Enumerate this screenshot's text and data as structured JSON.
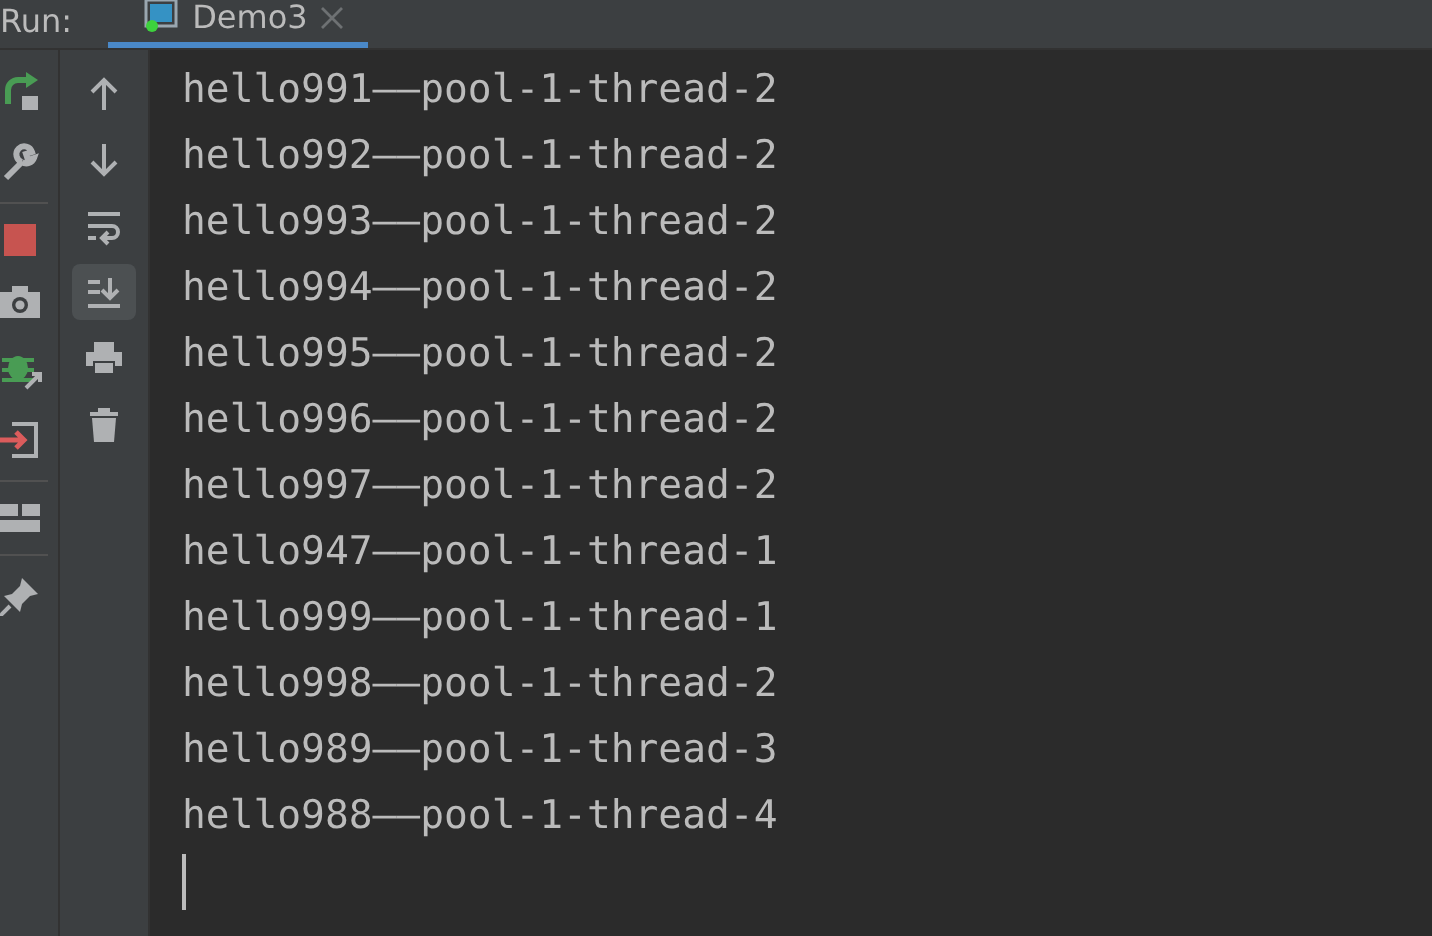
{
  "run_bar": {
    "label": "Run:",
    "tabs": [
      {
        "label": "Demo3",
        "selected": true,
        "closable": true
      }
    ]
  },
  "console": {
    "lines": [
      "hello991——pool-1-thread-2",
      "hello992——pool-1-thread-2",
      "hello993——pool-1-thread-2",
      "hello994——pool-1-thread-2",
      "hello995——pool-1-thread-2",
      "hello996——pool-1-thread-2",
      "hello997——pool-1-thread-2",
      "hello947——pool-1-thread-1",
      "hello999——pool-1-thread-1",
      "hello998——pool-1-thread-2",
      "hello989——pool-1-thread-3",
      "hello988——pool-1-thread-4"
    ],
    "cursor": true
  },
  "secondary_toolbar": [
    {
      "kind": "up",
      "selected": false
    },
    {
      "kind": "down",
      "selected": false
    },
    {
      "kind": "wrap",
      "selected": false
    },
    {
      "kind": "scroll-end",
      "selected": true
    },
    {
      "kind": "print",
      "selected": false
    },
    {
      "kind": "trash",
      "selected": false
    }
  ]
}
